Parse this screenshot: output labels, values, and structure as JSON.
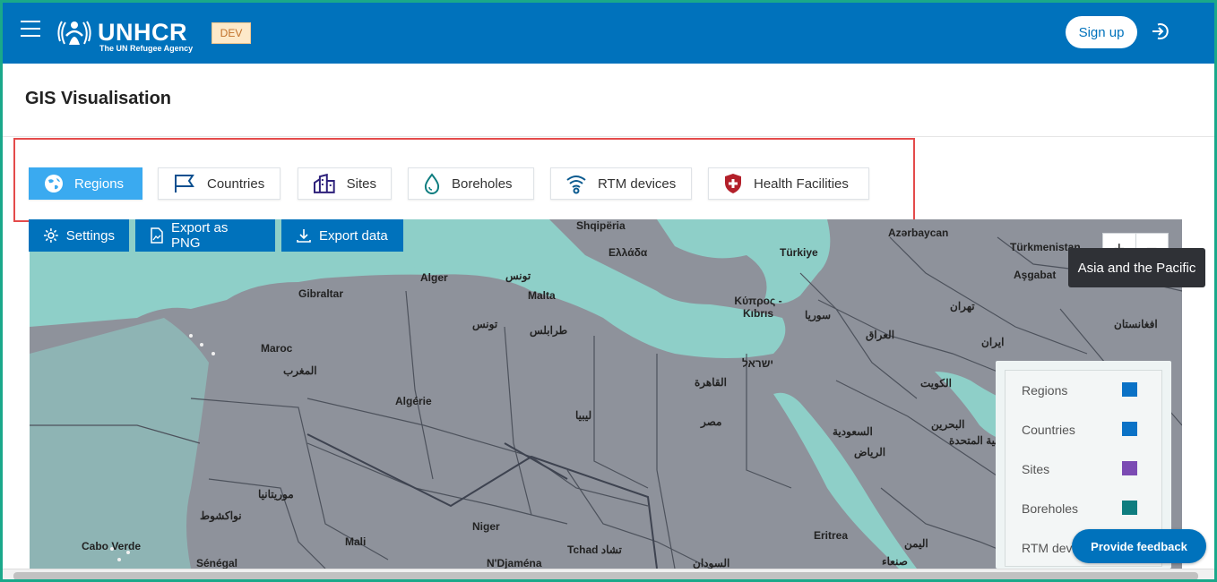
{
  "header": {
    "logo_text": "UNHCR",
    "logo_subtitle": "The UN Refugee Agency",
    "env_badge": "DEV",
    "signup_label": "Sign up"
  },
  "page": {
    "title": "GIS Visualisation"
  },
  "layers": [
    {
      "label": "Regions",
      "icon": "globe-icon",
      "active": true
    },
    {
      "label": "Countries",
      "icon": "flag-icon",
      "active": false
    },
    {
      "label": "Sites",
      "icon": "building-icon",
      "active": false
    },
    {
      "label": "Boreholes",
      "icon": "drop-icon",
      "active": false
    },
    {
      "label": "RTM devices",
      "icon": "wifi-signal-icon",
      "active": false
    },
    {
      "label": "Health Facilities",
      "icon": "health-shield-icon",
      "active": false
    }
  ],
  "toolbar": {
    "settings_label": "Settings",
    "export_png_label": "Export as PNG",
    "export_data_label": "Export data"
  },
  "map": {
    "zoom_in": "+",
    "zoom_out": "−",
    "tooltip": "Asia and the Pacific",
    "labels": [
      {
        "text": "Shqipëria"
      },
      {
        "text": "Ελλάδα"
      },
      {
        "text": "Türkiye"
      },
      {
        "text": "Azərbaycan"
      },
      {
        "text": "Türkmenistan"
      },
      {
        "text": "Aşgabat"
      },
      {
        "text": "Alger"
      },
      {
        "text": "تونس"
      },
      {
        "text": "Malta"
      },
      {
        "text": "Gibraltar"
      },
      {
        "text": "Κύπρος - Kıbrıs"
      },
      {
        "text": "سوريا"
      },
      {
        "text": "تهران"
      },
      {
        "text": "طرابلس"
      },
      {
        "text": "تونس"
      },
      {
        "text": "العراق"
      },
      {
        "text": "ایران"
      },
      {
        "text": "افغانستان"
      },
      {
        "text": "Maroc"
      },
      {
        "text": "المغرب"
      },
      {
        "text": "ישראל"
      },
      {
        "text": "القاهرة"
      },
      {
        "text": "الكويت"
      },
      {
        "text": "Algérie"
      },
      {
        "text": "ليبيا"
      },
      {
        "text": "مصر"
      },
      {
        "text": "البحرين"
      },
      {
        "text": "السعودية"
      },
      {
        "text": "الرياض"
      },
      {
        "text": "العربية المتحدة"
      },
      {
        "text": "موريتانيا"
      },
      {
        "text": "نواكشوط"
      },
      {
        "text": "Niger"
      },
      {
        "text": "Cabo Verde"
      },
      {
        "text": "Mali"
      },
      {
        "text": "Tchad تشاد"
      },
      {
        "text": "Eritrea"
      },
      {
        "text": "اليمن"
      },
      {
        "text": "Sénégal"
      },
      {
        "text": "N'Djaména"
      },
      {
        "text": "السودان"
      },
      {
        "text": "صنعاء"
      }
    ]
  },
  "legend": {
    "items": [
      {
        "label": "Regions",
        "color": "#0a72c6"
      },
      {
        "label": "Countries",
        "color": "#0a72c6"
      },
      {
        "label": "Sites",
        "color": "#7b4bb3"
      },
      {
        "label": "Boreholes",
        "color": "#0e7d7f"
      },
      {
        "label": "RTM devices",
        "color": "#0a72c6"
      }
    ]
  },
  "feedback_label": "Provide feedback",
  "colors": {
    "brand": "#0072bc",
    "active_layer": "#3aaaf0",
    "highlight_border": "#e44b4b",
    "map_land": "#8e929b",
    "map_water": "#8ecfc8"
  }
}
